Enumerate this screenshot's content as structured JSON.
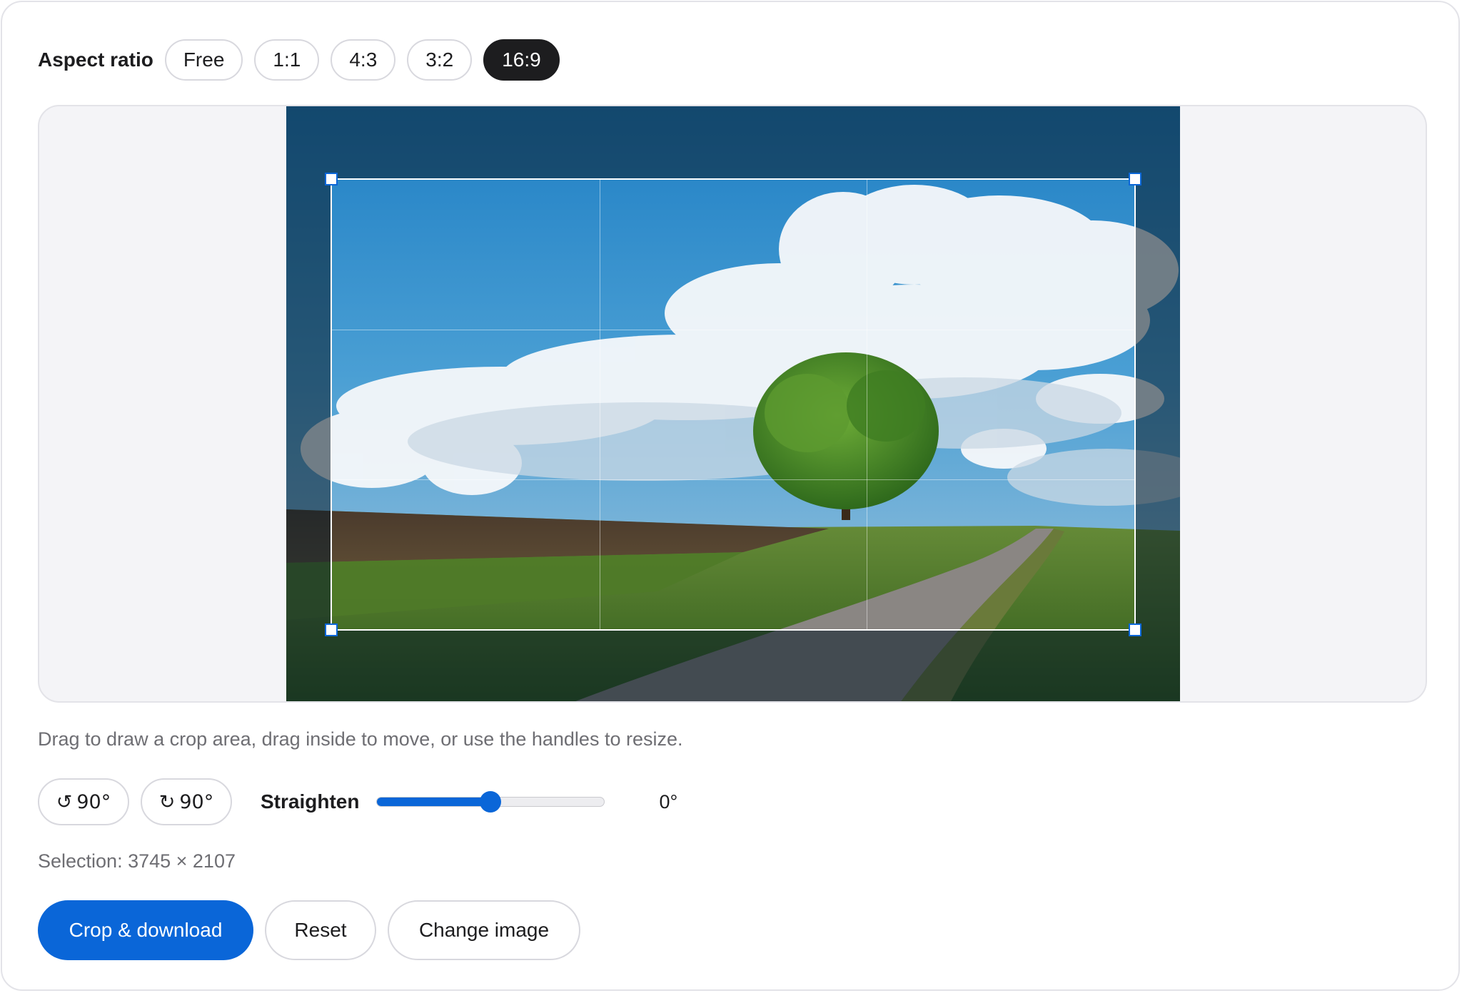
{
  "aspect": {
    "label": "Aspect ratio",
    "options": [
      "Free",
      "1:1",
      "4:3",
      "3:2",
      "16:9"
    ],
    "selected": "16:9"
  },
  "hint": "Drag to draw a crop area, drag inside to move, or use the handles to resize.",
  "rotate": {
    "left_glyph": "↺",
    "right_glyph": "↻",
    "left_label": "90°",
    "right_label": "90°"
  },
  "straighten": {
    "label": "Straighten",
    "value_text": "0°",
    "slider_fraction": 0.5
  },
  "selection": {
    "text": "Selection: 3745 × 2107"
  },
  "actions": {
    "crop_label": "Crop & download",
    "reset_label": "Reset",
    "change_label": "Change image"
  },
  "colors": {
    "accent": "#0a66d8",
    "active_pill": "#1d1d1f",
    "stage_bg": "#f4f4f7"
  }
}
